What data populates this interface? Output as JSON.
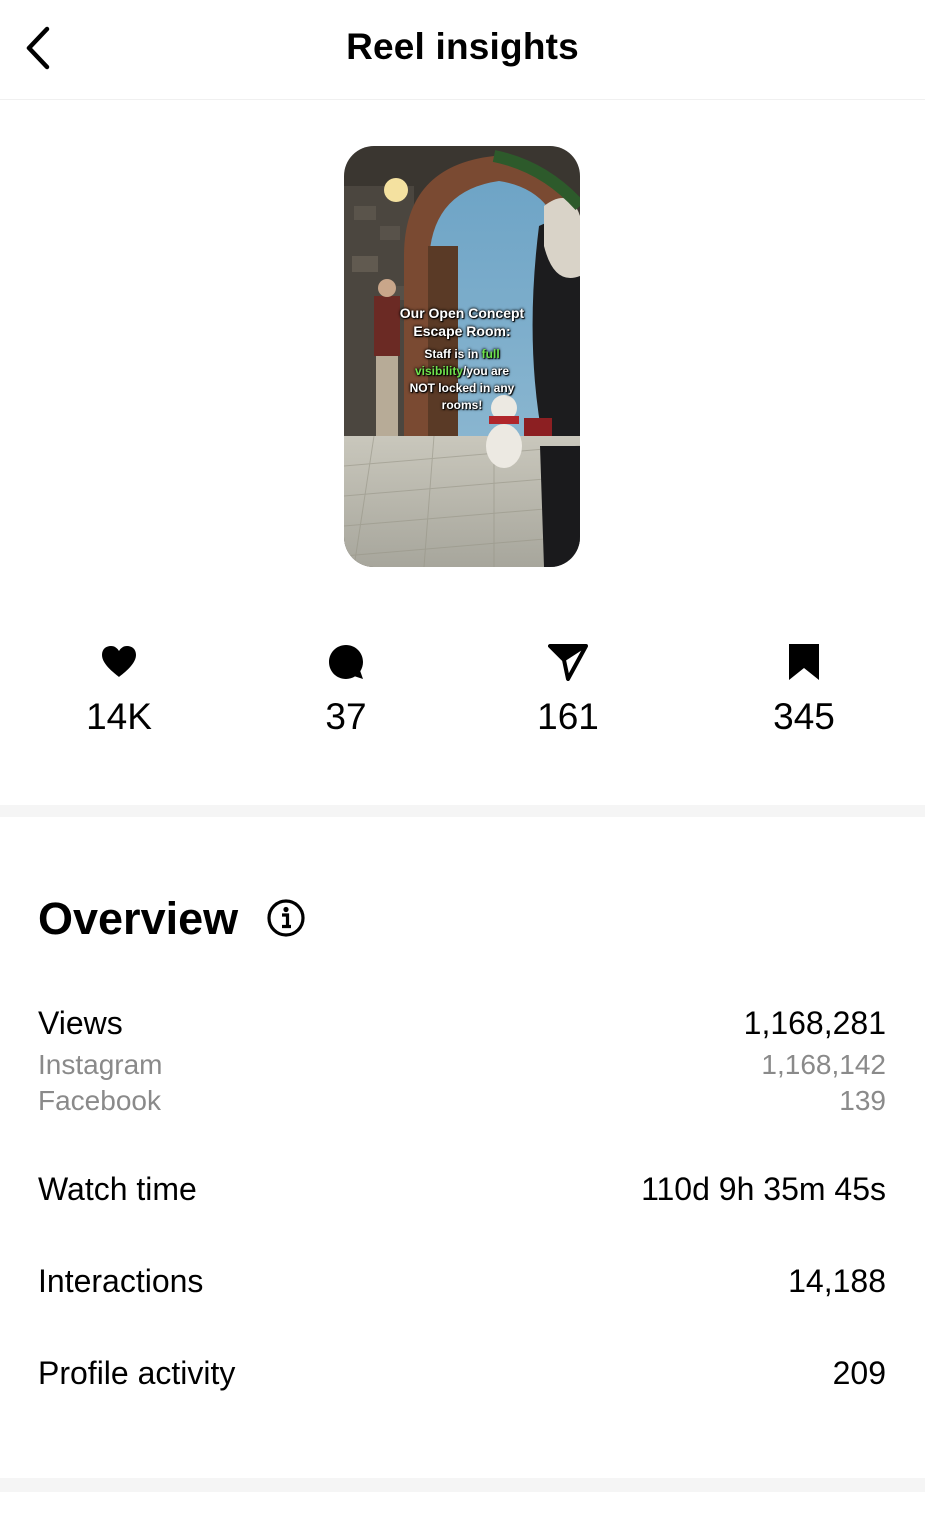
{
  "header": {
    "title": "Reel insights",
    "back_icon": "chevron-left-icon"
  },
  "reel": {
    "caption_line1": "Our Open Concept",
    "caption_line2": "Escape Room:",
    "caption_sub_a": "Staff is in ",
    "caption_sub_hl1": "full",
    "caption_sub_hl2": "visibility",
    "caption_sub_b": "/you are",
    "caption_sub_c": "NOT locked in any",
    "caption_sub_d": "rooms!",
    "highlight_color": "#6fe34d"
  },
  "stats": {
    "likes": {
      "icon": "heart-icon",
      "value": "14K"
    },
    "comments": {
      "icon": "comment-icon",
      "value": "37"
    },
    "shares": {
      "icon": "send-icon",
      "value": "161"
    },
    "saves": {
      "icon": "bookmark-icon",
      "value": "345"
    }
  },
  "overview": {
    "title": "Overview",
    "info_icon": "info-icon",
    "views": {
      "label": "Views",
      "value": "1,168,281",
      "instagram_label": "Instagram",
      "instagram_value": "1,168,142",
      "facebook_label": "Facebook",
      "facebook_value": "139"
    },
    "watch_time": {
      "label": "Watch time",
      "value": "110d 9h 35m 45s"
    },
    "interactions": {
      "label": "Interactions",
      "value": "14,188"
    },
    "profile_activity": {
      "label": "Profile activity",
      "value": "209"
    }
  },
  "colors": {
    "text": "#000000",
    "secondary_text": "#8a8a8a",
    "divider": "#f5f5f5"
  }
}
